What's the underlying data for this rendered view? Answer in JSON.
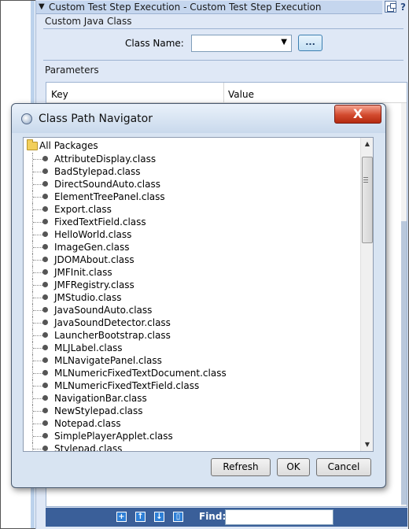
{
  "panel": {
    "title": "Custom Test Step Execution - Custom Test Step Execution",
    "help": "?"
  },
  "custom_java_class": {
    "section_title": "Custom Java Class",
    "class_name_label": "Class Name:",
    "class_name_value": "",
    "browse_label": "..."
  },
  "parameters": {
    "section_title": "Parameters",
    "columns": [
      "Key",
      "Value"
    ]
  },
  "bottom_bar": {
    "find_label": "Find:",
    "find_value": ""
  },
  "dialog": {
    "title": "Class Path Navigator",
    "close_label": "X",
    "root_label": "All Packages",
    "items": [
      "AttributeDisplay.class",
      "BadStylepad.class",
      "DirectSoundAuto.class",
      "ElementTreePanel.class",
      "Export.class",
      "FixedTextField.class",
      "HelloWorld.class",
      "ImageGen.class",
      "JDOMAbout.class",
      "JMFInit.class",
      "JMFRegistry.class",
      "JMStudio.class",
      "JavaSoundAuto.class",
      "JavaSoundDetector.class",
      "LauncherBootstrap.class",
      "MLJLabel.class",
      "MLNavigatePanel.class",
      "MLNumericFixedTextDocument.class",
      "MLNumericFixedTextField.class",
      "NavigationBar.class",
      "NewStylepad.class",
      "Notepad.class",
      "SimplePlayerApplet.class",
      "Stylepad.class"
    ],
    "buttons": {
      "refresh": "Refresh",
      "ok": "OK",
      "cancel": "Cancel"
    }
  }
}
